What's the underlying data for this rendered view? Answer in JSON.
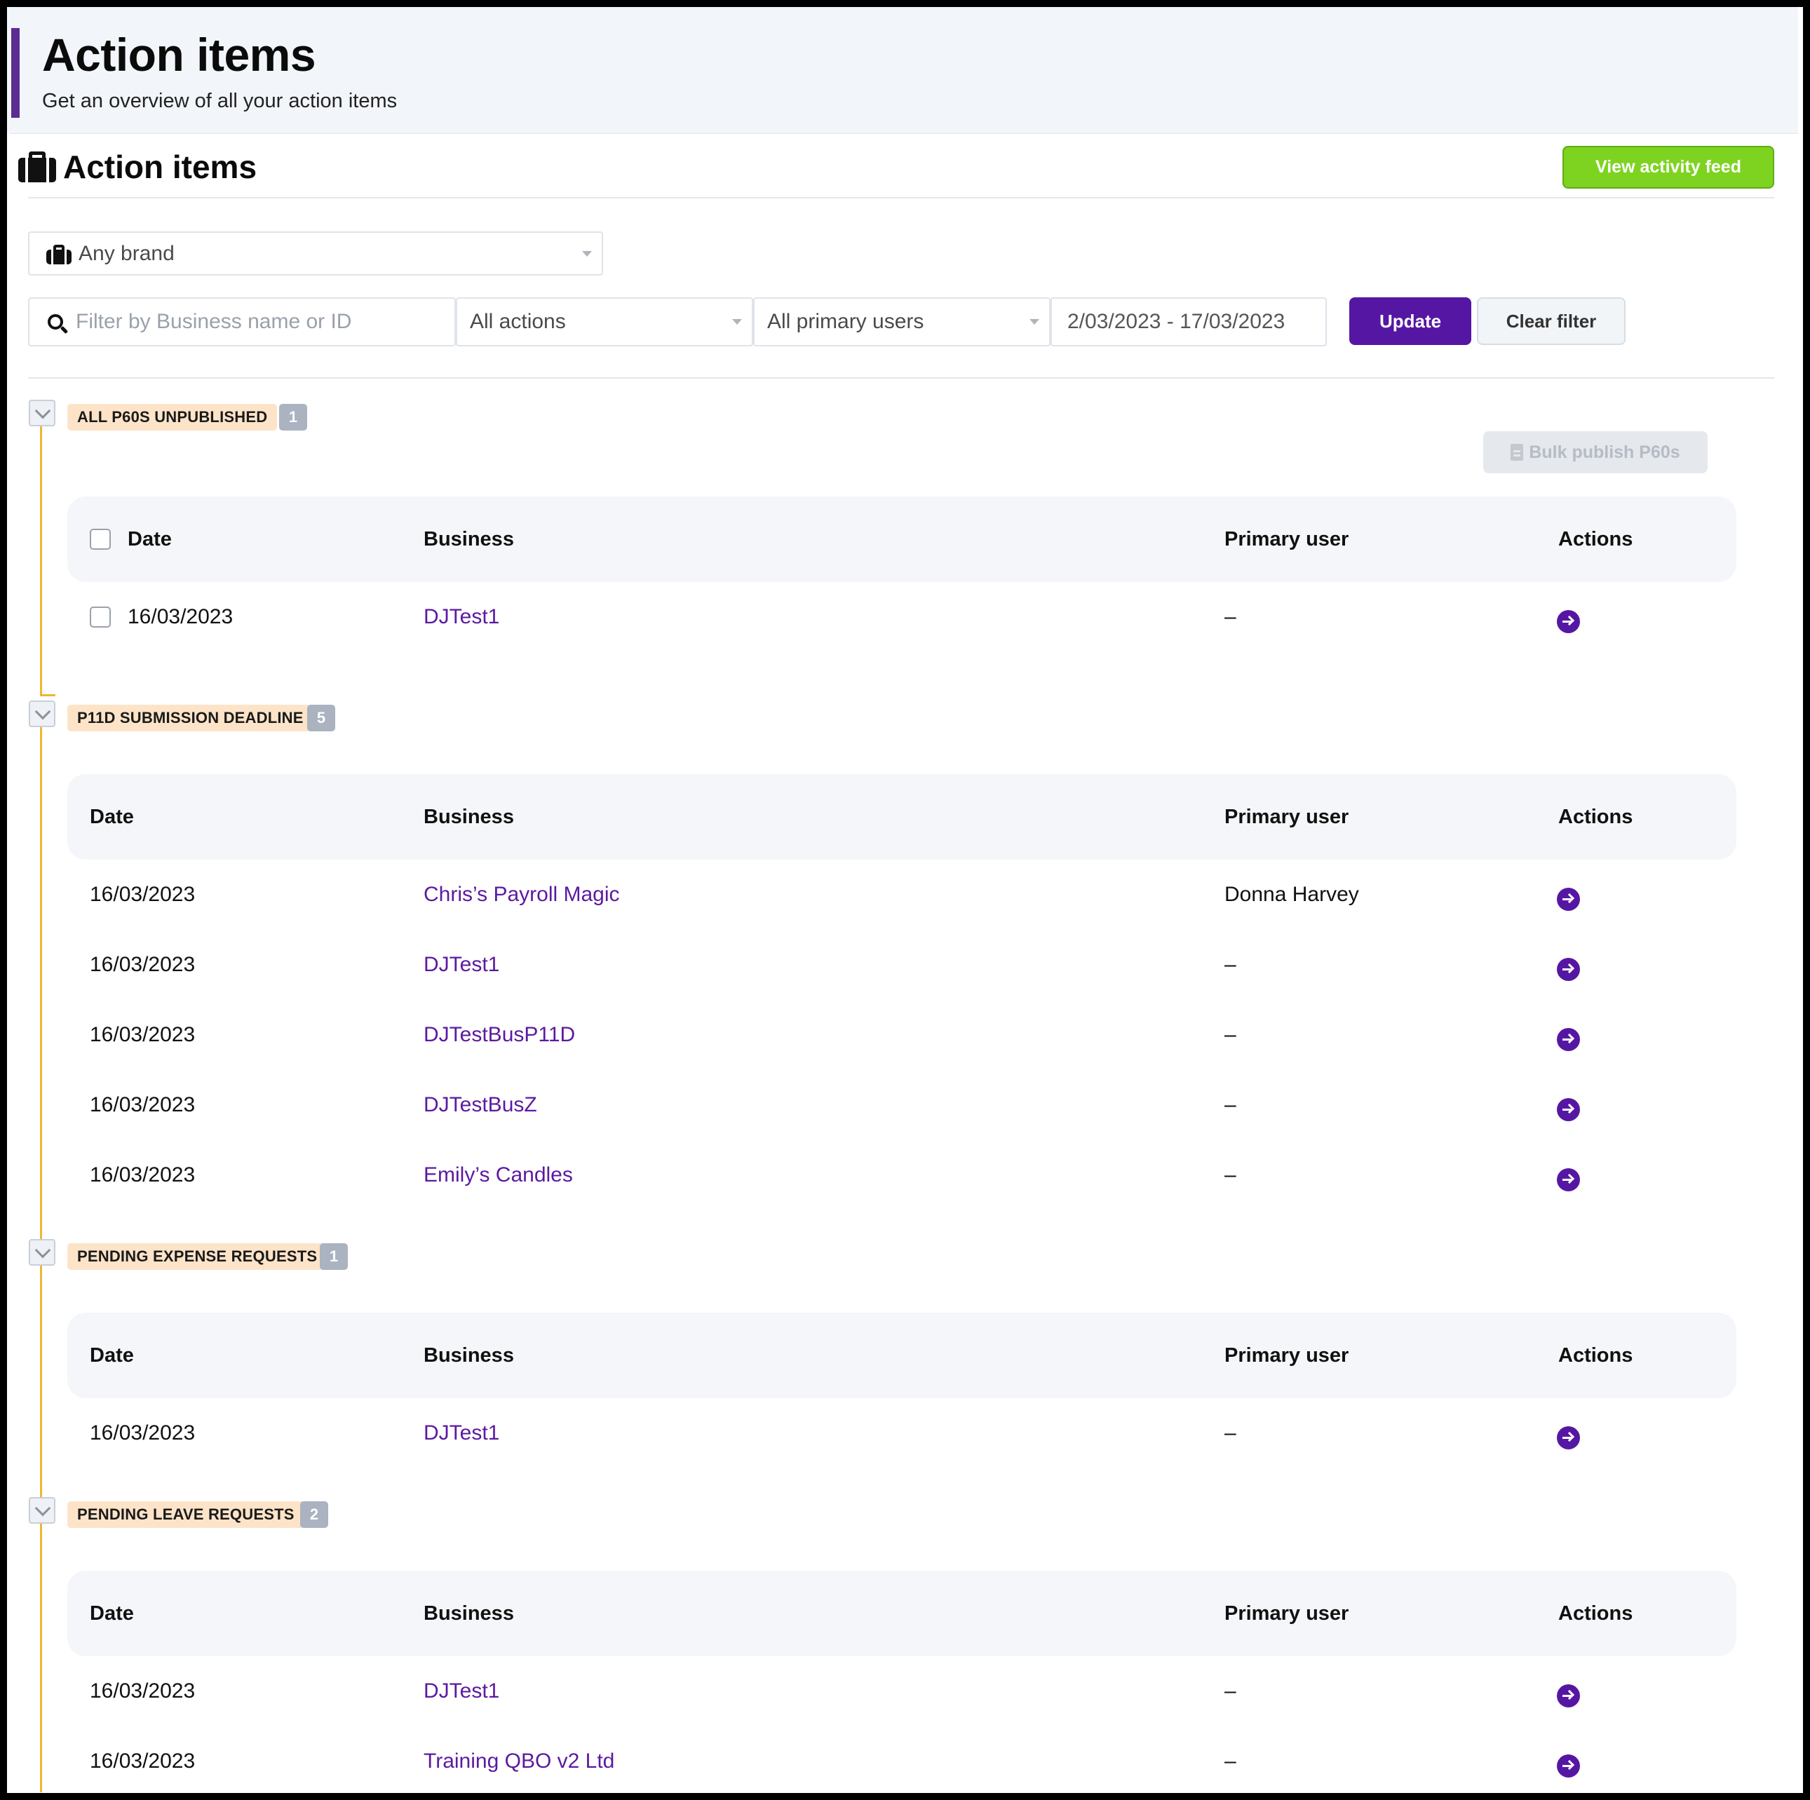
{
  "header": {
    "title": "Action items",
    "subtitle": "Get an overview of all your action items"
  },
  "card": {
    "title": "Action items",
    "title_icon": "briefcase-icon",
    "view_activity_label": "View activity feed"
  },
  "filters": {
    "brand": "Any brand",
    "search_placeholder": "Filter by Business name or ID",
    "actions": "All actions",
    "primary_users": "All primary users",
    "date_range": "2/03/2023 - 17/03/2023",
    "update_label": "Update",
    "clear_label": "Clear filter"
  },
  "columns": {
    "date": "Date",
    "business": "Business",
    "primary_user": "Primary user",
    "actions": "Actions"
  },
  "colors": {
    "brand_purple": "#5517a3",
    "green_button": "#7ed321",
    "tag_bg": "#fde4c8",
    "timeline": "#f0b534"
  },
  "groups": [
    {
      "tag": "ALL P60S UNPUBLISHED",
      "count": "1",
      "bulk_label": "Bulk publish P60s",
      "rows": [
        {
          "date": "16/03/2023",
          "business": "DJTest1",
          "primary_user": "–"
        }
      ]
    },
    {
      "tag": "P11D SUBMISSION DEADLINE",
      "count": "5",
      "rows": [
        {
          "date": "16/03/2023",
          "business": "Chris’s Payroll Magic",
          "primary_user": "Donna Harvey"
        },
        {
          "date": "16/03/2023",
          "business": "DJTest1",
          "primary_user": "–"
        },
        {
          "date": "16/03/2023",
          "business": "DJTestBusP11D",
          "primary_user": "–"
        },
        {
          "date": "16/03/2023",
          "business": "DJTestBusZ",
          "primary_user": "–"
        },
        {
          "date": "16/03/2023",
          "business": "Emily’s Candles",
          "primary_user": "–"
        }
      ]
    },
    {
      "tag": "PENDING EXPENSE REQUESTS",
      "count": "1",
      "rows": [
        {
          "date": "16/03/2023",
          "business": "DJTest1",
          "primary_user": "–"
        }
      ]
    },
    {
      "tag": "PENDING LEAVE REQUESTS",
      "count": "2",
      "rows": [
        {
          "date": "16/03/2023",
          "business": "DJTest1",
          "primary_user": "–"
        },
        {
          "date": "16/03/2023",
          "business": "Training QBO v2 Ltd",
          "primary_user": "–"
        }
      ]
    }
  ]
}
